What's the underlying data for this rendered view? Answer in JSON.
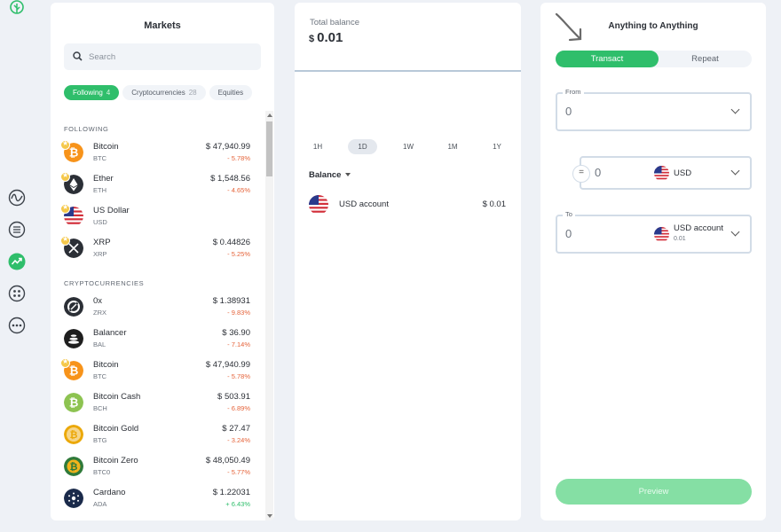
{
  "rail": {
    "icons": [
      "leaf-logo-icon",
      "activity-icon",
      "list-icon",
      "markets-icon",
      "grid-icon",
      "more-icon"
    ]
  },
  "markets": {
    "title": "Markets",
    "search_placeholder": "Search",
    "chips": [
      {
        "label": "Following",
        "count": "4"
      },
      {
        "label": "Cryptocurrencies",
        "count": "28"
      },
      {
        "label": "Equities",
        "count": ""
      }
    ],
    "sections": [
      {
        "title": "FOLLOWING",
        "rows": [
          {
            "name": "Bitcoin",
            "sym": "BTC",
            "price": "$ 47,940.99",
            "change": "- 5.78%",
            "dir": "neg"
          },
          {
            "name": "Ether",
            "sym": "ETH",
            "price": "$ 1,548.56",
            "change": "- 4.65%",
            "dir": "neg"
          },
          {
            "name": "US Dollar",
            "sym": "USD",
            "price": "",
            "change": "",
            "dir": ""
          },
          {
            "name": "XRP",
            "sym": "XRP",
            "price": "$ 0.44826",
            "change": "- 5.25%",
            "dir": "neg"
          }
        ]
      },
      {
        "title": "CRYPTOCURRENCIES",
        "rows": [
          {
            "name": "0x",
            "sym": "ZRX",
            "price": "$ 1.38931",
            "change": "- 9.83%",
            "dir": "neg"
          },
          {
            "name": "Balancer",
            "sym": "BAL",
            "price": "$ 36.90",
            "change": "- 7.14%",
            "dir": "neg"
          },
          {
            "name": "Bitcoin",
            "sym": "BTC",
            "price": "$ 47,940.99",
            "change": "- 5.78%",
            "dir": "neg"
          },
          {
            "name": "Bitcoin Cash",
            "sym": "BCH",
            "price": "$ 503.91",
            "change": "- 6.89%",
            "dir": "neg"
          },
          {
            "name": "Bitcoin Gold",
            "sym": "BTG",
            "price": "$ 27.47",
            "change": "- 3.24%",
            "dir": "neg"
          },
          {
            "name": "Bitcoin Zero",
            "sym": "BTC0",
            "price": "$ 48,050.49",
            "change": "- 5.77%",
            "dir": "neg"
          },
          {
            "name": "Cardano",
            "sym": "ADA",
            "price": "$ 1.22031",
            "change": "+ 6.43%",
            "dir": "pos"
          }
        ]
      }
    ]
  },
  "balance": {
    "total_label": "Total balance",
    "currency_symbol": "$",
    "total_value": "0.01",
    "ranges": [
      "1H",
      "1D",
      "1W",
      "1M",
      "1Y"
    ],
    "active_range": "1D",
    "section_label": "Balance",
    "account_label": "USD account",
    "account_amount": "$ 0.01"
  },
  "exchange": {
    "title": "Anything to Anything",
    "tabs": [
      "Transact",
      "Repeat"
    ],
    "active_tab": "Transact",
    "from_label": "From",
    "from_value": "0",
    "amount_value": "0",
    "amount_currency": "USD",
    "to_label": "To",
    "to_value": "0",
    "to_account": "USD account",
    "to_account_balance": "0.01",
    "preview_label": "Preview"
  },
  "colors": {
    "accent": "#2fbe6b",
    "negative": "#e5643b",
    "preview_disabled": "#85dfa4"
  }
}
